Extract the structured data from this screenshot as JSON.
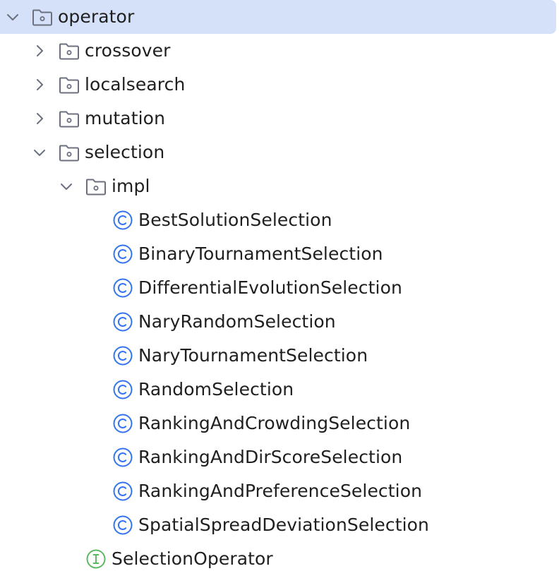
{
  "tree": {
    "operator": {
      "label": "operator",
      "expanded": true,
      "icon": "folder-package-icon"
    },
    "crossover": {
      "label": "crossover",
      "expanded": false,
      "icon": "folder-package-icon"
    },
    "localsearch": {
      "label": "localsearch",
      "expanded": false,
      "icon": "folder-package-icon"
    },
    "mutation": {
      "label": "mutation",
      "expanded": false,
      "icon": "folder-package-icon"
    },
    "selection": {
      "label": "selection",
      "expanded": true,
      "icon": "folder-package-icon"
    },
    "impl": {
      "label": "impl",
      "expanded": true,
      "icon": "folder-package-icon"
    },
    "classes": [
      {
        "label": "BestSolutionSelection",
        "icon": "class-icon"
      },
      {
        "label": "BinaryTournamentSelection",
        "icon": "class-icon"
      },
      {
        "label": "DifferentialEvolutionSelection",
        "icon": "class-icon"
      },
      {
        "label": "NaryRandomSelection",
        "icon": "class-icon"
      },
      {
        "label": "NaryTournamentSelection",
        "icon": "class-icon"
      },
      {
        "label": "RandomSelection",
        "icon": "class-icon"
      },
      {
        "label": "RankingAndCrowdingSelection",
        "icon": "class-icon"
      },
      {
        "label": "RankingAndDirScoreSelection",
        "icon": "class-icon"
      },
      {
        "label": "RankingAndPreferenceSelection",
        "icon": "class-icon"
      },
      {
        "label": "SpatialSpreadDeviationSelection",
        "icon": "class-icon"
      }
    ],
    "interface": {
      "label": "SelectionOperator",
      "icon": "interface-icon"
    }
  },
  "colors": {
    "selected_row": "#d5e1f9",
    "class_icon": "#3574f0",
    "interface_icon": "#5fb865",
    "folder_icon": "#6c707e"
  }
}
